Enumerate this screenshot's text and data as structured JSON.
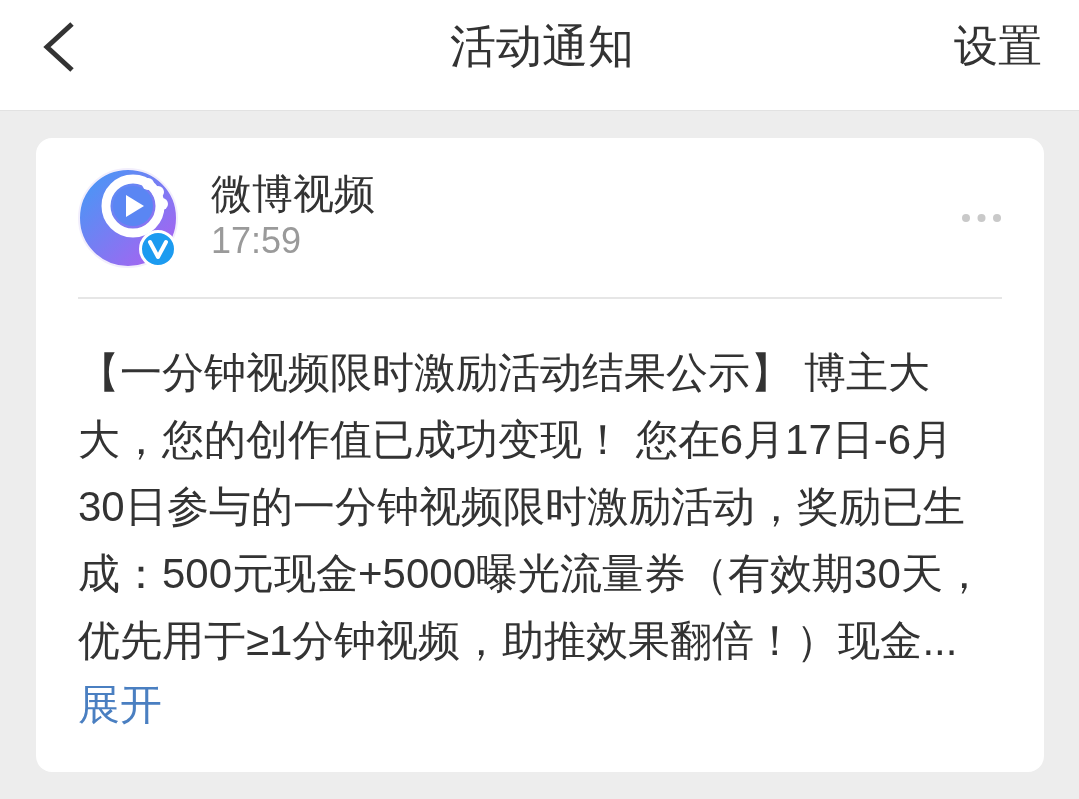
{
  "header": {
    "title": "活动通知",
    "action": "设置"
  },
  "notification": {
    "sender": {
      "name": "微博视频",
      "verified": true
    },
    "time": "17:59",
    "body": "【一分钟视频限时激励活动结果公示】 博主大大，您的创作值已成功变现！ 您在6月17日-6月30日参与的一分钟视频限时激励活动，奖励已生成：500元现金+5000曝光流量券（有效期30天，优先用于≥1分钟视频，助推效果翻倍！）现金...",
    "expand_link": "展开"
  }
}
